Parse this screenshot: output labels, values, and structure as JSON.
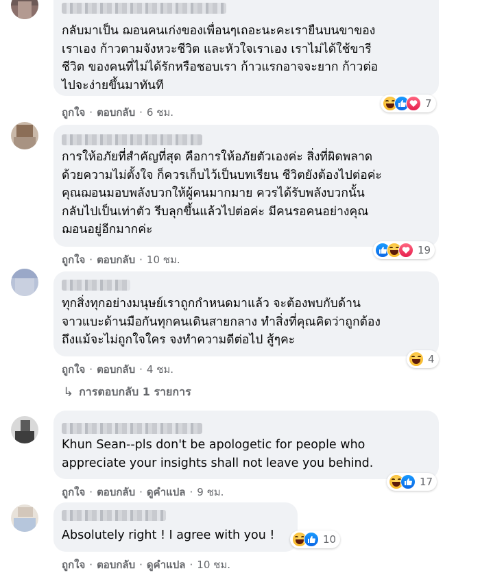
{
  "comments": [
    {
      "lines": [
        "กลับมาเป็น ฌอนคนเก่งของเพื่อนๆเถอะนะคะเรายืนบนขาของ",
        "เราเอง ก้าวตามจังหวะชีวิต และหัวใจเราเอง เราไม่ได้ใช้ขารี",
        "ชีวิต ของคนที่ไม่ได้รักหรือชอบเรา ก้าวแรกอาจจะยาก ก้าวต่อ",
        "ไปจะง่ายขึ้นมาทันที"
      ],
      "reaction_count": "7",
      "like_label": "ถูกใจ",
      "reply_label": "ตอบกลับ",
      "time": "6 ชม."
    },
    {
      "lines": [
        "การให้อภัยที่สำคัญที่สุด คือการให้อภัยตัวเองค่ะ สิ่งที่ผิดพลาด",
        "ด้วยความไม่ตั้งใจ ก็ควรเก็บไว้เป็นบทเรียน ชีวิตยังต้องไปต่อค่ะ",
        "คุณฌอนมอบพลังบวกให้ผู้คนมากมาย ควรได้รับพลังบวกนั้น",
        "กลับไปเป็นเท่าตัว รีบลุกขึ้นแล้วไปต่อค่ะ มีคนรอคนอย่างคุณ",
        "ฌอนอยู่อีกมากค่ะ"
      ],
      "reaction_count": "19",
      "like_label": "ถูกใจ",
      "reply_label": "ตอบกลับ",
      "time": "10 ชม."
    },
    {
      "lines": [
        "ทุกสิ่งทุกอย่างมนุษย์เราถูกกำหนดมาแล้ว จะต้องพบกับด้าน",
        "จาวแบะด้านมือกันทุกคนเดินสายกลาง ทำสิ่งที่คุณคิดว่าถูกต้อง",
        "ถึงแม้จะไม่ถูกใจใคร จงทำความดีต่อไป สู้ๆคะ"
      ],
      "reaction_count": "4",
      "like_label": "ถูกใจ",
      "reply_label": "ตอบกลับ",
      "time": "4 ชม.",
      "replies_label": "การตอบกลับ 1 รายการ"
    },
    {
      "lines": [
        "Khun Sean--pls don't be apologetic for people who",
        "appreciate your insights shall not leave you behind."
      ],
      "reaction_count": "17",
      "like_label": "ถูกใจ",
      "reply_label": "ตอบกลับ",
      "translate_label": "ดูคำแปล",
      "time": "9 ชม."
    },
    {
      "lines": [
        "Absolutely right ! I agree with you !"
      ],
      "reaction_count": "10",
      "like_label": "ถูกใจ",
      "reply_label": "ตอบกลับ",
      "translate_label": "ดูคำแปล",
      "time": "10 ชม."
    }
  ],
  "icons": {
    "reply_arrow": "↳",
    "haha": "haha-reaction-icon",
    "like": "like-reaction-icon",
    "love": "love-reaction-icon"
  },
  "colors": {
    "bubble": "#f0f2f5",
    "secondary_text": "#65676b",
    "like_blue": "#0b66e4",
    "haha_yellow": "#f8b92a",
    "love_red": "#e61e4d"
  }
}
